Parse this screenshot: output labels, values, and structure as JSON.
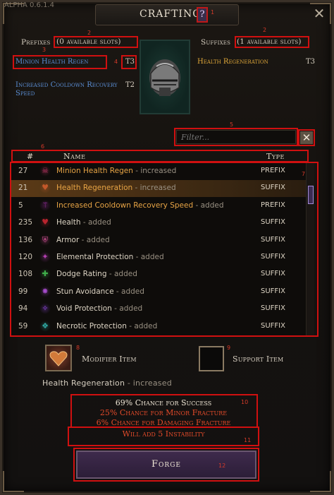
{
  "window": {
    "version": "ALPHA 0.6.1.4",
    "title": "CRAFTING",
    "help": "?",
    "close": "✕"
  },
  "annotations": [
    "1",
    "2",
    "3",
    "4",
    "5",
    "6",
    "7",
    "8",
    "9",
    "10",
    "11",
    "12"
  ],
  "prefixes": {
    "label": "Prefixes",
    "slots": "(0 available slots)",
    "item": {
      "name": "Minion Health Regen",
      "tier": "T3"
    }
  },
  "suffixes": {
    "label": "Suffixes",
    "slots": "(1 available slots)",
    "item": {
      "name": "Health Regeneration",
      "tier": "T3"
    }
  },
  "extra_prefix": {
    "name": "Increased Cooldown Recovery Speed",
    "tier": "T2"
  },
  "filter": {
    "placeholder": "Filter..."
  },
  "table": {
    "headers": {
      "num": "#",
      "name": "Name",
      "type": "Type"
    },
    "rows": [
      {
        "num": "27",
        "name": "Minion Health Regen",
        "suffix": " - increased",
        "type": "PREFIX",
        "color": "orange",
        "icon": "minion-icon",
        "icon_color": "#b0325e"
      },
      {
        "num": "21",
        "name": "Health Regeneration",
        "suffix": " - increased",
        "type": "SUFFIX",
        "color": "orange",
        "icon": "heart-icon",
        "icon_color": "#c2582a",
        "selected": true
      },
      {
        "num": "5",
        "name": "Increased Cooldown Recovery Speed",
        "suffix": " - added",
        "type": "PREFIX",
        "color": "orange",
        "icon": "wand-icon",
        "icon_color": "#9b2fa2"
      },
      {
        "num": "235",
        "name": "Health",
        "suffix": " - added",
        "type": "SUFFIX",
        "color": "white",
        "icon": "health-icon",
        "icon_color": "#b8242e"
      },
      {
        "num": "136",
        "name": "Armor",
        "suffix": " - added",
        "type": "SUFFIX",
        "color": "white",
        "icon": "armor-icon",
        "icon_color": "#c24a8a"
      },
      {
        "num": "120",
        "name": "Elemental Protection",
        "suffix": " - added",
        "type": "SUFFIX",
        "color": "white",
        "icon": "elemental-icon",
        "icon_color": "#b33fb1"
      },
      {
        "num": "108",
        "name": "Dodge Rating",
        "suffix": " - added",
        "type": "SUFFIX",
        "color": "white",
        "icon": "dodge-icon",
        "icon_color": "#3fae4a"
      },
      {
        "num": "99",
        "name": "Stun Avoidance",
        "suffix": " - added",
        "type": "SUFFIX",
        "color": "white",
        "icon": "stun-icon",
        "icon_color": "#a34ac8"
      },
      {
        "num": "94",
        "name": "Void Protection",
        "suffix": " - added",
        "type": "SUFFIX",
        "color": "white",
        "icon": "void-icon",
        "icon_color": "#8a46d8"
      },
      {
        "num": "59",
        "name": "Necrotic Protection",
        "suffix": " - added",
        "type": "SUFFIX",
        "color": "white",
        "icon": "necrotic-icon",
        "icon_color": "#2fa6a0"
      }
    ]
  },
  "modifier": {
    "label": "Modifier Item",
    "selected": "Health Regeneration",
    "selected_suffix": " - increased"
  },
  "support": {
    "label": "Support Item"
  },
  "chances": {
    "success": "69% Chance for Success",
    "minor": "25% Chance for Minor Fracture",
    "damaging": "6% Chance for Damaging Fracture",
    "instability": "Will add 5 Instability"
  },
  "colors": {
    "success": "#efe6d6",
    "fracture": "#e24a2a"
  },
  "forge": {
    "label": "Forge"
  }
}
